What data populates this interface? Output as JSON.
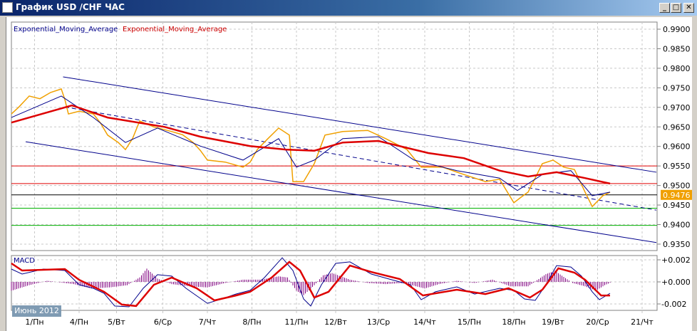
{
  "window": {
    "title": "График USD /CHF  ЧАС",
    "minimize": "_",
    "maximize": "□",
    "close": "✕"
  },
  "legend": [
    {
      "label": "Exponential_Moving_Average",
      "color": "#00008b"
    },
    {
      "label": "Exponential_Moving_Average",
      "color": "#cc0000"
    }
  ],
  "macd_label": "MACD",
  "period_badge": "Июнь 2012",
  "chart_data": {
    "type": "line",
    "title": "USD/CHF H1",
    "x_unit": "hourly bar index",
    "x_ticks": [
      {
        "bar": 13,
        "label": "1/Пн"
      },
      {
        "bar": 38,
        "label": "4/Пн"
      },
      {
        "bar": 59,
        "label": "5/Вт"
      },
      {
        "bar": 85,
        "label": "6/Ср"
      },
      {
        "bar": 110,
        "label": "7/Чт"
      },
      {
        "bar": 135,
        "label": "8/Пн"
      },
      {
        "bar": 160,
        "label": "11/Пн"
      },
      {
        "bar": 182,
        "label": "12/Вт"
      },
      {
        "bar": 206,
        "label": "13/Ср"
      },
      {
        "bar": 232,
        "label": "14/Чт"
      },
      {
        "bar": 257,
        "label": "15/Пн"
      },
      {
        "bar": 282,
        "label": "18/Пн"
      },
      {
        "bar": 304,
        "label": "19/Вт"
      },
      {
        "bar": 329,
        "label": "20/Ср"
      },
      {
        "bar": 354,
        "label": "21/Чт"
      }
    ],
    "price_axis": {
      "ylim": [
        0.935,
        0.99
      ],
      "ticks": [
        "0.9900",
        "0.9850",
        "0.9800",
        "0.9750",
        "0.9700",
        "0.9650",
        "0.9600",
        "0.9550",
        "0.9500",
        "0.9450",
        "0.9400",
        "0.9350"
      ]
    },
    "current_price": {
      "label": "0.9476",
      "value": 0.9476,
      "color": "#f0a000"
    },
    "price": [
      [
        0,
        0.9683
      ],
      [
        4,
        0.97
      ],
      [
        10,
        0.9729
      ],
      [
        16,
        0.9722
      ],
      [
        22,
        0.9738
      ],
      [
        28,
        0.9747
      ],
      [
        30,
        0.972
      ],
      [
        32,
        0.9683
      ],
      [
        38,
        0.969
      ],
      [
        46,
        0.9683
      ],
      [
        50,
        0.966
      ],
      [
        54,
        0.9629
      ],
      [
        60,
        0.961
      ],
      [
        64,
        0.9592
      ],
      [
        68,
        0.962
      ],
      [
        72,
        0.9665
      ],
      [
        80,
        0.965
      ],
      [
        90,
        0.9638
      ],
      [
        96,
        0.963
      ],
      [
        102,
        0.961
      ],
      [
        106,
        0.959
      ],
      [
        110,
        0.9565
      ],
      [
        120,
        0.956
      ],
      [
        130,
        0.9547
      ],
      [
        134,
        0.956
      ],
      [
        138,
        0.9592
      ],
      [
        144,
        0.962
      ],
      [
        150,
        0.9647
      ],
      [
        156,
        0.9629
      ],
      [
        158,
        0.951
      ],
      [
        164,
        0.951
      ],
      [
        170,
        0.9556
      ],
      [
        176,
        0.9629
      ],
      [
        186,
        0.9638
      ],
      [
        200,
        0.9641
      ],
      [
        210,
        0.962
      ],
      [
        222,
        0.9592
      ],
      [
        230,
        0.9547
      ],
      [
        242,
        0.9547
      ],
      [
        254,
        0.9528
      ],
      [
        266,
        0.951
      ],
      [
        274,
        0.9516
      ],
      [
        282,
        0.9456
      ],
      [
        286,
        0.947
      ],
      [
        290,
        0.9483
      ],
      [
        298,
        0.9556
      ],
      [
        304,
        0.9565
      ],
      [
        310,
        0.9547
      ],
      [
        316,
        0.9541
      ],
      [
        322,
        0.9483
      ],
      [
        326,
        0.9446
      ],
      [
        332,
        0.9474
      ],
      [
        336,
        0.9483
      ]
    ],
    "ema_fast": {
      "color": "#00008b",
      "points": [
        [
          0,
          0.9674
        ],
        [
          28,
          0.9729
        ],
        [
          46,
          0.9674
        ],
        [
          64,
          0.961
        ],
        [
          82,
          0.9647
        ],
        [
          106,
          0.9601
        ],
        [
          130,
          0.9565
        ],
        [
          150,
          0.962
        ],
        [
          160,
          0.9547
        ],
        [
          170,
          0.9565
        ],
        [
          186,
          0.962
        ],
        [
          206,
          0.9625
        ],
        [
          226,
          0.9565
        ],
        [
          250,
          0.9538
        ],
        [
          274,
          0.9519
        ],
        [
          284,
          0.9487
        ],
        [
          298,
          0.9528
        ],
        [
          314,
          0.9538
        ],
        [
          326,
          0.9474
        ],
        [
          336,
          0.9483
        ]
      ]
    },
    "ema_slow": {
      "color": "#dd0000",
      "points": [
        [
          0,
          0.9661
        ],
        [
          34,
          0.9705
        ],
        [
          54,
          0.9674
        ],
        [
          86,
          0.965
        ],
        [
          106,
          0.9625
        ],
        [
          134,
          0.9601
        ],
        [
          154,
          0.9592
        ],
        [
          170,
          0.9589
        ],
        [
          186,
          0.961
        ],
        [
          206,
          0.9614
        ],
        [
          234,
          0.9583
        ],
        [
          254,
          0.957
        ],
        [
          274,
          0.9538
        ],
        [
          290,
          0.9523
        ],
        [
          306,
          0.9534
        ],
        [
          322,
          0.9519
        ],
        [
          336,
          0.9505
        ]
      ]
    },
    "horizontal_lines": [
      {
        "value": 0.955,
        "color": "#e00000"
      },
      {
        "value": 0.9505,
        "color": "#e00000"
      },
      {
        "value": 0.9476,
        "color": "#000000"
      },
      {
        "value": 0.9442,
        "color": "#00b000"
      },
      {
        "value": 0.9398,
        "color": "#00b000"
      }
    ],
    "channel": {
      "color": "#00008b",
      "lines": [
        {
          "kind": "upper",
          "from": [
            29,
            0.9778
          ],
          "to": [
            362,
            0.9534
          ]
        },
        {
          "kind": "middle",
          "dashed": true,
          "from": [
            30,
            0.9701
          ],
          "to": [
            362,
            0.9437
          ]
        },
        {
          "kind": "lower",
          "from": [
            8,
            0.9612
          ],
          "to": [
            362,
            0.9354
          ]
        }
      ]
    },
    "macd": {
      "ylim": [
        -0.0025,
        0.0025
      ],
      "ticks": [
        {
          "value": 0.002,
          "label": "+0.002"
        },
        {
          "value": 0,
          "label": "+0.000"
        },
        {
          "value": -0.002,
          "label": "-0.002"
        }
      ],
      "main": [
        [
          0,
          0.00116
        ],
        [
          6,
          0.00071
        ],
        [
          18,
          0.00116
        ],
        [
          30,
          0.00103
        ],
        [
          38,
          -0.00026
        ],
        [
          46,
          -0.00058
        ],
        [
          52,
          -0.00103
        ],
        [
          58,
          -0.00219
        ],
        [
          66,
          -0.00226
        ],
        [
          74,
          -0.00058
        ],
        [
          82,
          0.00065
        ],
        [
          90,
          0.00052
        ],
        [
          98,
          -0.00058
        ],
        [
          110,
          -0.00194
        ],
        [
          118,
          -0.00155
        ],
        [
          126,
          -0.0011
        ],
        [
          134,
          -0.00077
        ],
        [
          142,
          0.00039
        ],
        [
          152,
          0.00219
        ],
        [
          158,
          0.00103
        ],
        [
          164,
          -0.00155
        ],
        [
          168,
          -0.00219
        ],
        [
          174,
          -0.00026
        ],
        [
          182,
          0.00168
        ],
        [
          190,
          0.00181
        ],
        [
          202,
          0.00071
        ],
        [
          212,
          0.00026
        ],
        [
          224,
          -0.00026
        ],
        [
          230,
          -0.00161
        ],
        [
          238,
          -0.0009
        ],
        [
          250,
          -0.00045
        ],
        [
          260,
          -0.0011
        ],
        [
          274,
          -0.00058
        ],
        [
          282,
          -0.00077
        ],
        [
          288,
          -0.00155
        ],
        [
          294,
          -0.00168
        ],
        [
          300,
          -0.00026
        ],
        [
          306,
          0.00148
        ],
        [
          314,
          0.00135
        ],
        [
          320,
          0.00052
        ],
        [
          326,
          -0.0009
        ],
        [
          330,
          -0.00161
        ],
        [
          336,
          -0.00103
        ]
      ],
      "signal": [
        [
          0,
          0.00168
        ],
        [
          6,
          0.00103
        ],
        [
          30,
          0.00116
        ],
        [
          38,
          0.00019
        ],
        [
          52,
          -0.0009
        ],
        [
          62,
          -0.00206
        ],
        [
          70,
          -0.00219
        ],
        [
          80,
          -0.00026
        ],
        [
          90,
          0.00039
        ],
        [
          104,
          -0.00058
        ],
        [
          114,
          -0.00168
        ],
        [
          126,
          -0.00123
        ],
        [
          134,
          -0.0009
        ],
        [
          146,
          0.00039
        ],
        [
          156,
          0.00181
        ],
        [
          162,
          0.00103
        ],
        [
          170,
          -0.00142
        ],
        [
          178,
          -0.0009
        ],
        [
          190,
          0.00148
        ],
        [
          202,
          0.0009
        ],
        [
          218,
          0.00026
        ],
        [
          231,
          -0.00123
        ],
        [
          250,
          -0.00071
        ],
        [
          266,
          -0.0011
        ],
        [
          279,
          -0.00058
        ],
        [
          291,
          -0.00142
        ],
        [
          298,
          -0.00071
        ],
        [
          307,
          0.00123
        ],
        [
          316,
          0.00084
        ],
        [
          322,
          0.00019
        ],
        [
          331,
          -0.00123
        ],
        [
          336,
          -0.00123
        ]
      ],
      "histogram": [
        [
          0,
          -0.0008
        ],
        [
          10,
          -0.0003
        ],
        [
          20,
          0.0001
        ],
        [
          35,
          -0.0002
        ],
        [
          45,
          -0.0006
        ],
        [
          55,
          -0.0005
        ],
        [
          65,
          -0.0003
        ],
        [
          72,
          0.0004
        ],
        [
          76,
          0.0012
        ],
        [
          82,
          0.0003
        ],
        [
          90,
          -0.0002
        ],
        [
          100,
          -0.0004
        ],
        [
          110,
          -0.0005
        ],
        [
          120,
          -0.0001
        ],
        [
          130,
          0.0002
        ],
        [
          140,
          0.0002
        ],
        [
          150,
          0.0005
        ],
        [
          155,
          0.0004
        ],
        [
          160,
          -0.0008
        ],
        [
          164,
          -0.0012
        ],
        [
          170,
          -0.0003
        ],
        [
          175,
          0.0006
        ],
        [
          180,
          0.0008
        ],
        [
          190,
          0.0002
        ],
        [
          200,
          -0.0001
        ],
        [
          210,
          -0.0002
        ],
        [
          220,
          -0.0001
        ],
        [
          232,
          -0.0006
        ],
        [
          240,
          -0.0002
        ],
        [
          250,
          0.0001
        ],
        [
          260,
          -0.0001
        ],
        [
          270,
          0.0002
        ],
        [
          280,
          -0.0004
        ],
        [
          290,
          -0.0004
        ],
        [
          300,
          0.0007
        ],
        [
          305,
          0.001
        ],
        [
          315,
          -0.0001
        ],
        [
          322,
          -0.0004
        ],
        [
          328,
          -0.0008
        ],
        [
          333,
          -0.0003
        ],
        [
          337,
          0
        ]
      ]
    }
  }
}
